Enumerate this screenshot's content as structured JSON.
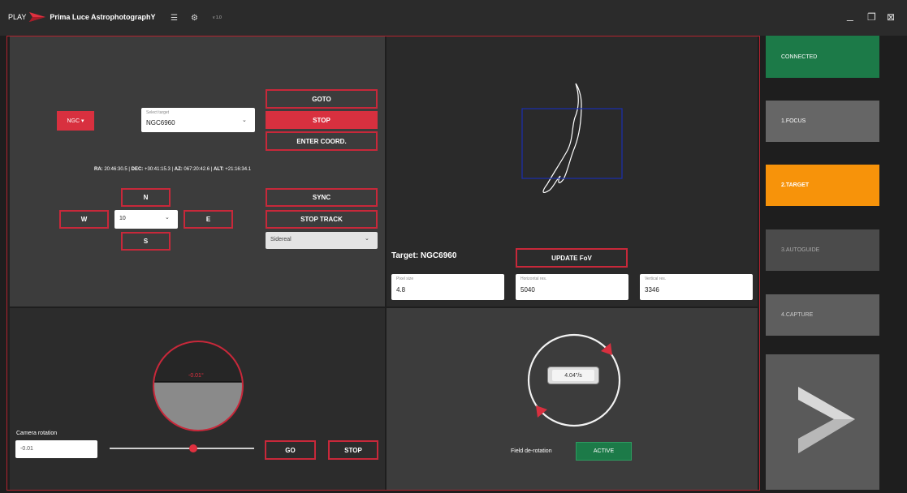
{
  "title_bar": {
    "brand_play": "PLAY",
    "brand_name": "Prima Luce AstrophotographY",
    "version": "v 1.0",
    "minimize": "_",
    "maximize": "❐",
    "close": "⊠"
  },
  "mount": {
    "catalog_button": "NGC ▾",
    "select_target": {
      "label": "Select target",
      "value": "NGC6960"
    },
    "goto": "GOTO",
    "stop": "STOP",
    "enter_coord": "ENTER COORD.",
    "coords": {
      "ra_label": "RA:",
      "ra_value": "20:46:30.5",
      "dec_label": "DEC:",
      "dec_value": "+30:41:15.3",
      "az_label": "AZ:",
      "az_value": "067:20:42.6",
      "alt_label": "ALT:",
      "alt_value": "+21:16:34.1",
      "sep": "|"
    },
    "north": "N",
    "south": "S",
    "east": "E",
    "west": "W",
    "speed": "10",
    "sync": "SYNC",
    "stop_track": "STOP TRACK",
    "tracking_mode": "Sidereal"
  },
  "fov": {
    "target_label": "Target: NGC6960",
    "update_fov": "UPDATE FoV",
    "pixel_size": {
      "label": "Pixel size",
      "value": "4.8"
    },
    "horizontal_res": {
      "label": "Horizontal res.",
      "value": "5040"
    },
    "vertical_res": {
      "label": "Vertical res.",
      "value": "3346"
    }
  },
  "rotator": {
    "angle": "-0.01°",
    "camera_rotation_label": "Camera rotation",
    "camera_rotation_value": "-0.01",
    "slider_fraction": 0.58,
    "go": "GO",
    "stop": "STOP"
  },
  "derotation": {
    "rate": "4.04\"/s",
    "label": "Field de-rotation",
    "status": "ACTIVE"
  },
  "sidebar": {
    "connected": "CONNECTED",
    "focus": "1.FOCUS",
    "target": "2.TARGET",
    "autoguide": "3.AUTOGUIDE",
    "capture": "4.CAPTURE"
  },
  "colors": {
    "accent_red": "#d8303f",
    "connected_green": "#1c7a48",
    "active_orange": "#f7930a",
    "fov_frame_blue": "#1a2fb0"
  }
}
